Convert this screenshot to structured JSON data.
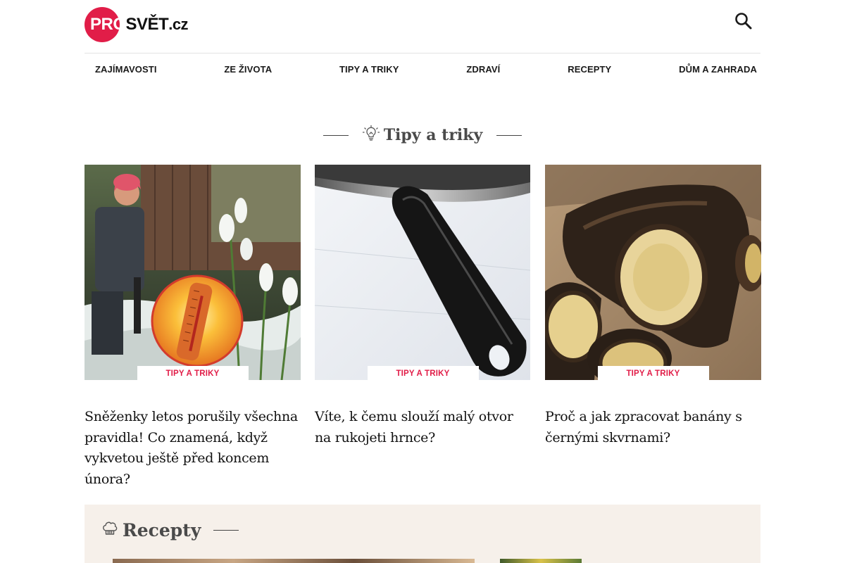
{
  "header": {
    "logo_pro": "PRO",
    "logo_svet": "SVĚT",
    "logo_cz": ".cz",
    "search_icon": "search-icon"
  },
  "nav": {
    "items": [
      {
        "label": "ZAJÍMAVOSTI"
      },
      {
        "label": "ZE ŽIVOTA"
      },
      {
        "label": "TIPY A TRIKY"
      },
      {
        "label": "ZDRAVÍ"
      },
      {
        "label": "RECEPTY"
      },
      {
        "label": "DŮM A ZAHRADA"
      }
    ]
  },
  "section": {
    "title": "Tipy a triky",
    "icon": "lightbulb-icon"
  },
  "cards": [
    {
      "tag": "TIPY A TRIKY",
      "title": "Sněženky letos porušily všechna pravidla! Co znamená, když vykvetou ještě před koncem února?",
      "image": "snowdrops-thermometer-image"
    },
    {
      "tag": "TIPY A TRIKY",
      "title": "Víte, k čemu slouží malý otvor na rukojeti hrnce?",
      "image": "pot-handle-image"
    },
    {
      "tag": "TIPY A TRIKY",
      "title": "Proč a jak zpracovat banány s černými skvrnami?",
      "image": "black-bananas-image"
    }
  ],
  "recepty": {
    "title": "Recepty",
    "icon": "chef-hat-icon"
  },
  "colors": {
    "brand": "#e11d48",
    "heading": "#4a4a4a",
    "recepty_bg": "#f6f0ea"
  }
}
